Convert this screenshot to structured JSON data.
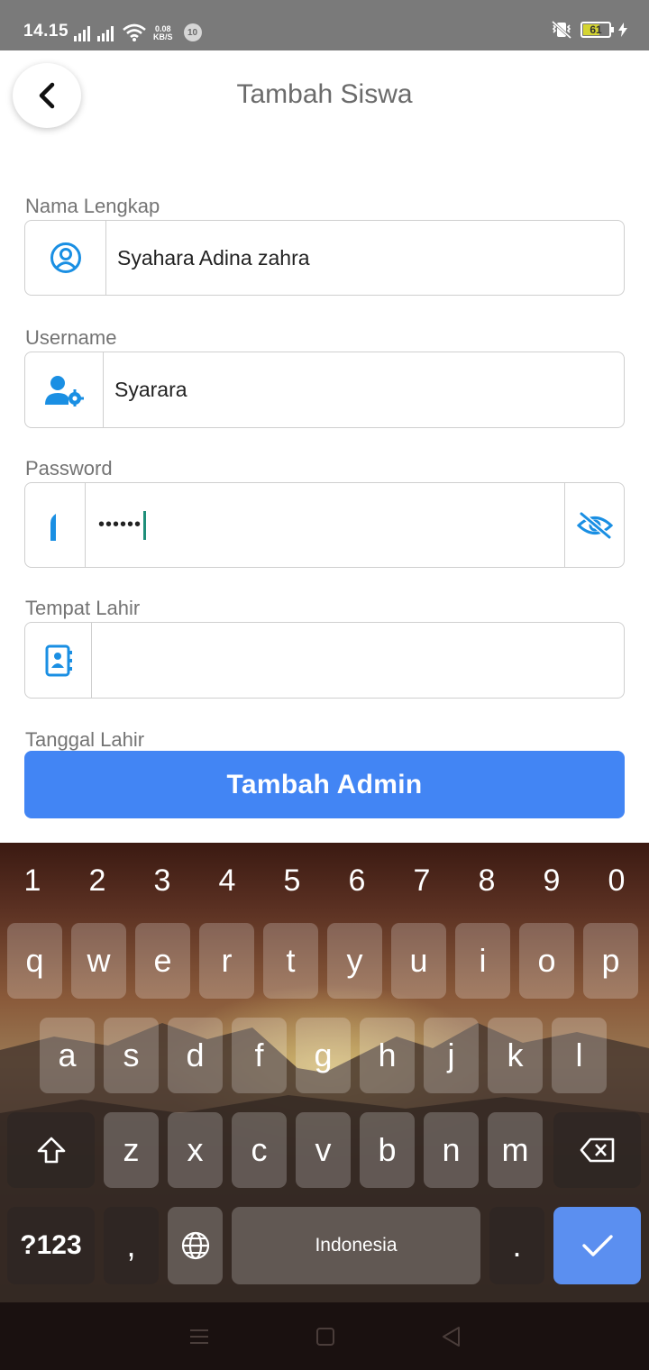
{
  "status_bar": {
    "time": "14.15",
    "speed_value": "0.08",
    "speed_unit": "KB/S",
    "notification_count": "10",
    "battery": "61"
  },
  "header": {
    "title": "Tambah Siswa",
    "back_icon": "chevron-left-icon"
  },
  "form": {
    "fields": [
      {
        "label": "Nama Lengkap",
        "value": "Syahara Adina zahra",
        "icon": "user-circle-icon"
      },
      {
        "label": "Username",
        "value": "Syarara",
        "icon": "user-gear-icon"
      },
      {
        "label": "Password",
        "value": "••••••",
        "icon": "lock-icon",
        "toggle_icon": "eye-slash-icon"
      },
      {
        "label": "Tempat Lahir",
        "value": "",
        "icon": "address-book-icon"
      }
    ],
    "next_label": "Tanggal Lahir",
    "submit_label": "Tambah Admin"
  },
  "keyboard": {
    "number_row": [
      "1",
      "2",
      "3",
      "4",
      "5",
      "6",
      "7",
      "8",
      "9",
      "0"
    ],
    "row1": [
      "q",
      "w",
      "e",
      "r",
      "t",
      "y",
      "u",
      "i",
      "o",
      "p"
    ],
    "row2": [
      "a",
      "s",
      "d",
      "f",
      "g",
      "h",
      "j",
      "k",
      "l"
    ],
    "row3": [
      "z",
      "x",
      "c",
      "v",
      "b",
      "n",
      "m"
    ],
    "symbols_label": "?123",
    "comma": ",",
    "space_label": "Indonesia",
    "period": ".",
    "accent_color": "#5b8ff0"
  },
  "colors": {
    "primary": "#4285f4",
    "icon_blue": "#1a8fe3"
  }
}
